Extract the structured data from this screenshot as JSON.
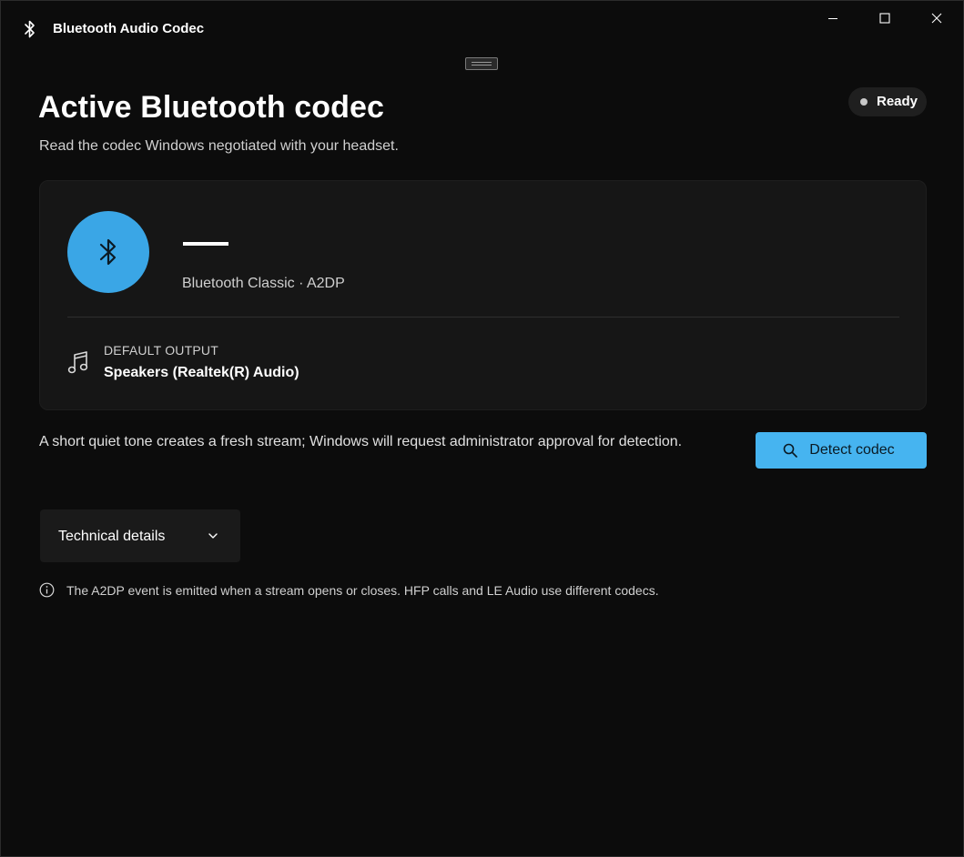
{
  "window": {
    "title": "Bluetooth Audio Codec"
  },
  "header": {
    "title": "Active Bluetooth codec",
    "subtitle": "Read the codec Windows negotiated with your headset.",
    "status": "Ready"
  },
  "codec_card": {
    "codec_name": "—",
    "protocol": "Bluetooth Classic · A2DP",
    "output_label": "DEFAULT OUTPUT",
    "output_device": "Speakers (Realtek(R) Audio)"
  },
  "detect": {
    "description": "A short quiet tone creates a fresh stream; Windows will request administrator approval for detection.",
    "button_label": "Detect codec"
  },
  "technical": {
    "label": "Technical details"
  },
  "info": {
    "text": "The A2DP event is emitted when a stream opens or closes. HFP calls and LE Audio use different codecs."
  },
  "icons": {
    "app": "bluetooth-icon",
    "codec": "bluetooth-icon",
    "output": "music-note-icon",
    "detect": "search-icon",
    "expander": "chevron-down-icon",
    "info": "info-icon"
  },
  "colors": {
    "accent": "#46b4f0",
    "accent_circle": "#3aa6e6",
    "background": "#0c0c0c",
    "card": "#161616"
  }
}
